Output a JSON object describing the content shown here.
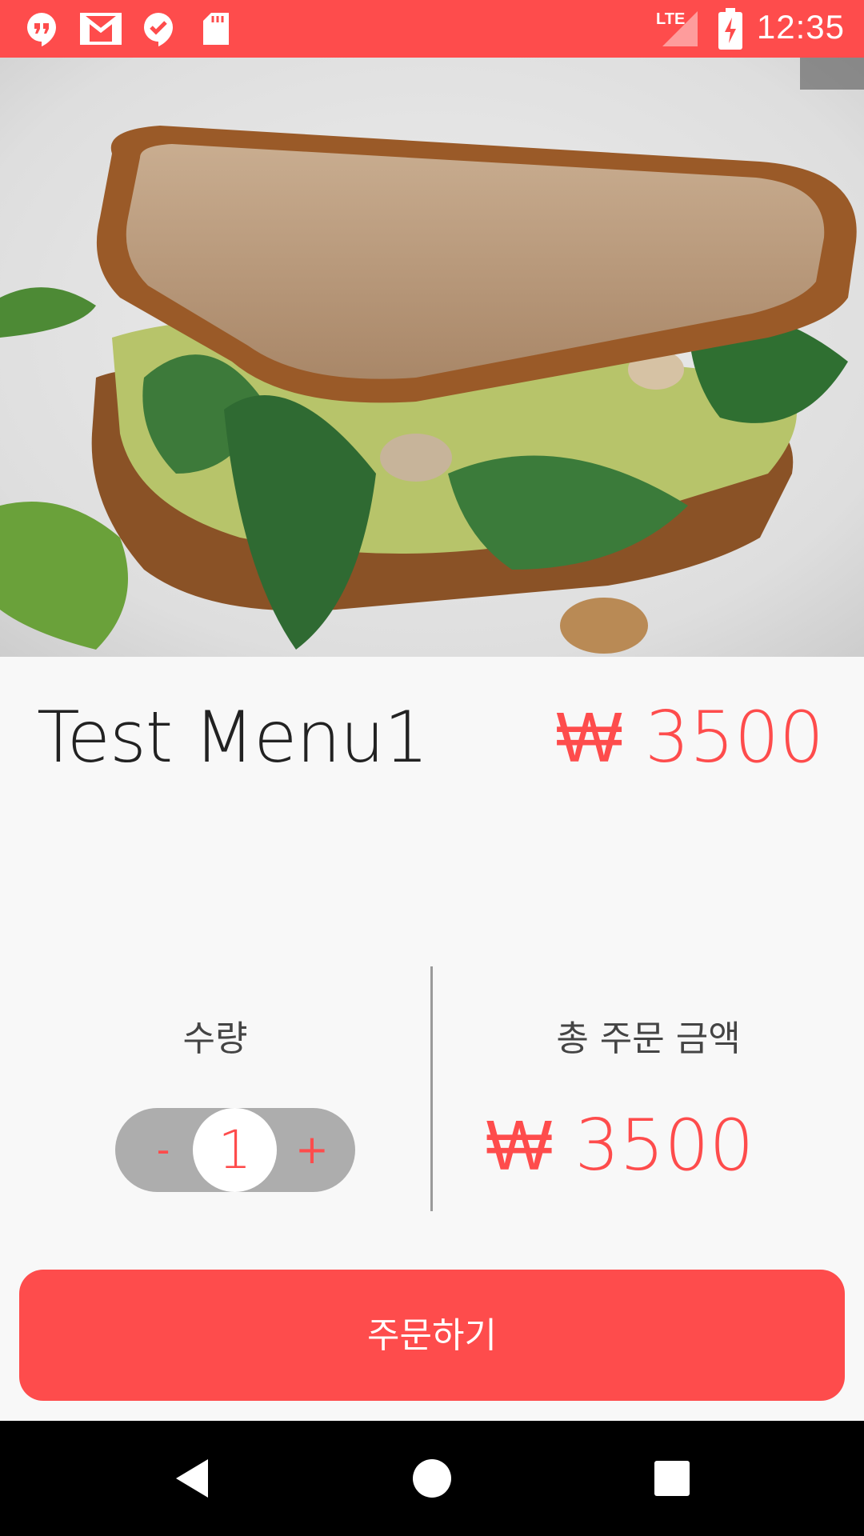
{
  "status_bar": {
    "time": "12:35",
    "network": "LTE",
    "icons": [
      "hangouts-icon",
      "gmail-icon",
      "checkmark-chat-icon",
      "sd-card-icon",
      "signal-icon",
      "battery-charging-icon"
    ]
  },
  "menu": {
    "title": "Test Menu1",
    "price": "₩ 3500"
  },
  "quantity": {
    "label": "수량",
    "minus": "-",
    "value": "1",
    "plus": "+"
  },
  "total": {
    "label": "총 주문 금액",
    "amount": "₩ 3500"
  },
  "order_button": {
    "label": "주문하기"
  },
  "colors": {
    "accent": "#fe4c4c",
    "stepper_bg": "#adadad",
    "background": "#f8f8f8"
  },
  "nav_icons": [
    "back-icon",
    "home-icon",
    "recents-icon"
  ]
}
